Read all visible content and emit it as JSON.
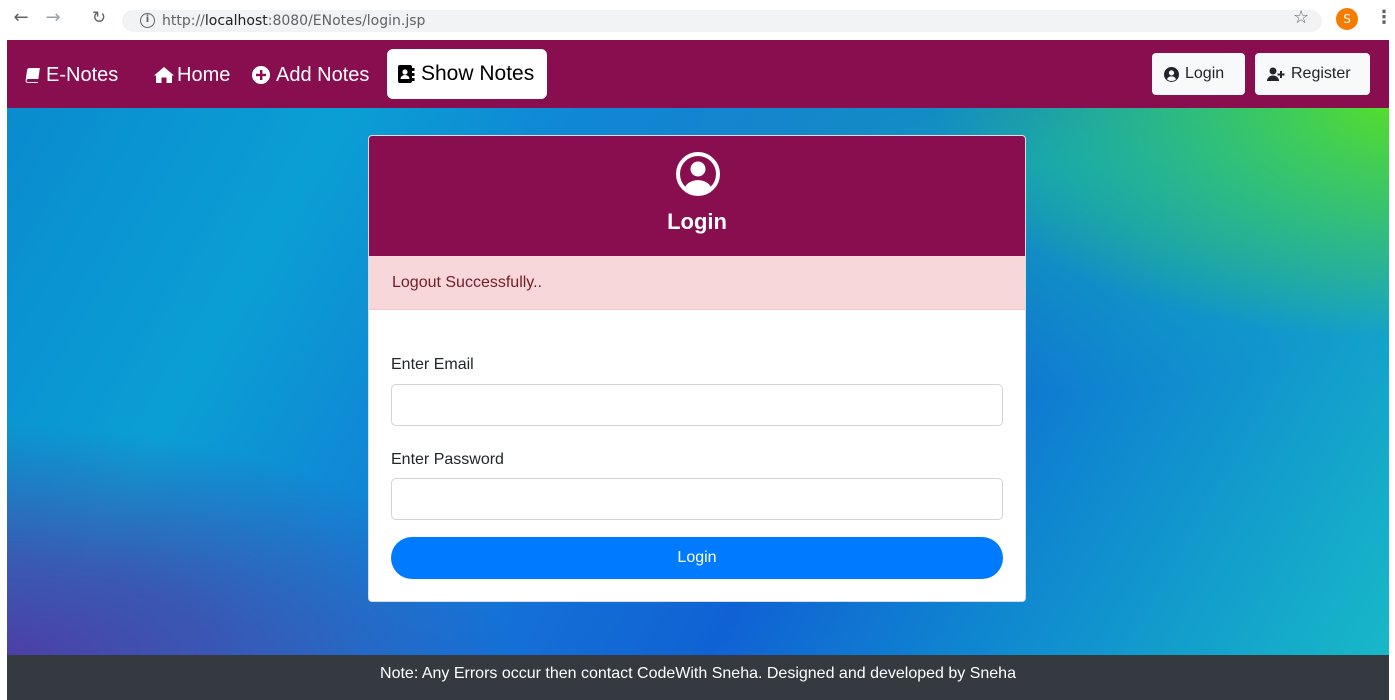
{
  "browser": {
    "url_prefix": "http://",
    "url_host": "localhost",
    "url_rest": ":8080/ENotes/login.jsp",
    "profile_initial": "S"
  },
  "navbar": {
    "brand": "E-Notes",
    "home": "Home",
    "add_notes": "Add Notes",
    "show_notes": "Show Notes",
    "login": "Login",
    "register": "Register",
    "bg_color": "#880e4f"
  },
  "login_card": {
    "title": "Login",
    "alert": "Logout Successfully..",
    "email_label": "Enter Email",
    "email_value": "",
    "password_label": "Enter Password",
    "password_value": "",
    "submit_label": "Login"
  },
  "footer": {
    "text": "Note: Any Errors occur then contact CodeWith Sneha. Designed and developed by Sneha"
  }
}
